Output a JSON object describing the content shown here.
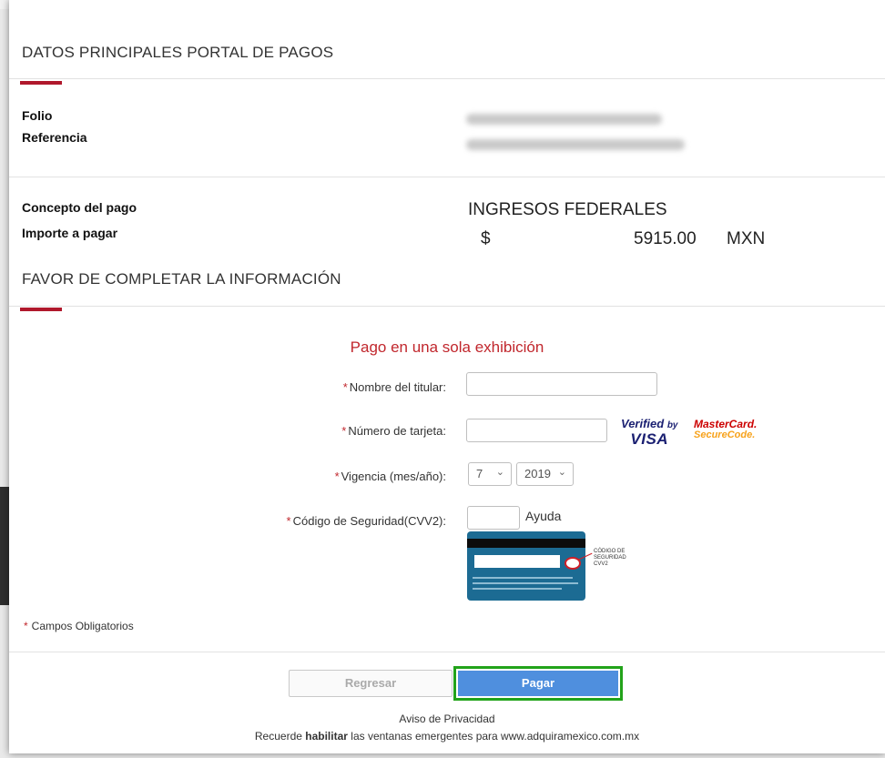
{
  "corner_badge": "S",
  "main_section": {
    "title": "DATOS PRINCIPALES PORTAL DE PAGOS",
    "folio_label": "Folio",
    "referencia_label": "Referencia",
    "concepto_label": "Concepto del pago",
    "importe_label": "Importe a pagar",
    "concepto_value": "INGRESOS FEDERALES",
    "currency_symbol": "$",
    "amount": "5915.00",
    "currency": "MXN"
  },
  "form_section": {
    "title": "FAVOR DE COMPLETAR LA INFORMACIÓN",
    "subtitle": "Pago en una sola exhibición",
    "required_mark": "*",
    "fields": {
      "titular_label": "Nombre del titular:",
      "tarjeta_label": "Número de tarjeta:",
      "vigencia_label": "Vigencia (mes/año):",
      "cvv_label": "Código de Seguridad(CVV2):"
    },
    "vigencia_month": "7",
    "vigencia_year": "2019",
    "help_text": "Ayuda",
    "verified_by": "Verified",
    "verified_by_small": "by",
    "visa": "VISA",
    "mastercard": "MasterCard.",
    "securecode": "SecureCode.",
    "cvv_note": "CÓDIGO DE SEGURIDAD CVV2",
    "required_note": "Campos Obligatorios"
  },
  "buttons": {
    "back": "Regresar",
    "pay": "Pagar"
  },
  "footer": {
    "privacy": "Aviso de Privacidad",
    "popup_before": "Recuerde ",
    "popup_bold": "habilitar",
    "popup_after": " las ventanas emergentes para www.adquiramexico.com.mx"
  },
  "colors": {
    "accent_red": "#b0182c",
    "button_blue": "#4f8fde",
    "highlight_green": "#22a31a"
  }
}
